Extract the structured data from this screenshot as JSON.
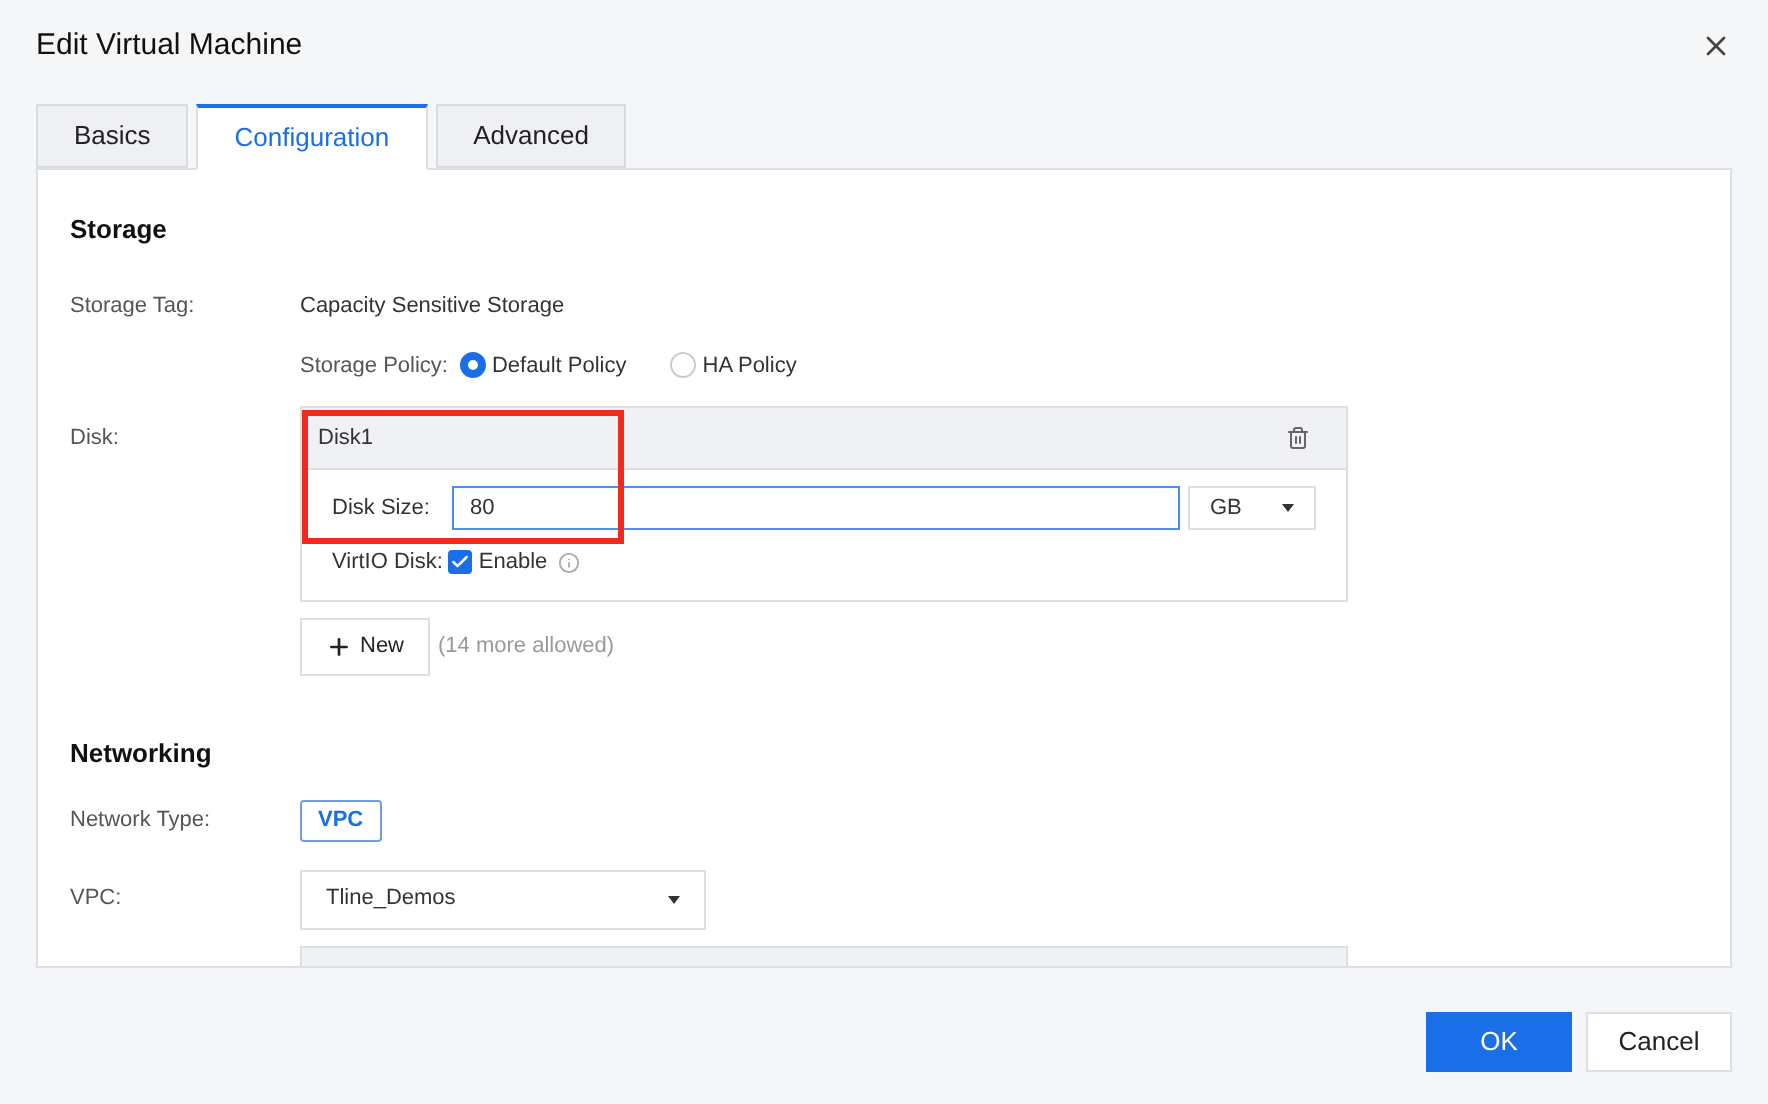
{
  "window": {
    "title": "Edit Virtual Machine"
  },
  "tabs": [
    {
      "label": "Basics",
      "selected": false
    },
    {
      "label": "Configuration",
      "selected": true
    },
    {
      "label": "Advanced",
      "selected": false
    }
  ],
  "storage": {
    "heading": "Storage",
    "tag_label": "Storage Tag:",
    "tag_value": "Capacity Sensitive Storage",
    "policy_label": "Storage Policy:",
    "policies": [
      {
        "label": "Default Policy",
        "selected": true
      },
      {
        "label": "HA Policy",
        "selected": false
      }
    ],
    "disk_label": "Disk:",
    "disks": [
      {
        "title": "Disk1",
        "size_label": "Disk Size:",
        "size_value": "80",
        "unit": "GB",
        "virtio_label": "VirtIO Disk:",
        "virtio_option": "Enable",
        "virtio_checked": true
      }
    ],
    "new_button": "New",
    "allowance": "(14 more allowed)"
  },
  "networking": {
    "heading": "Networking",
    "type_label": "Network Type:",
    "type_value": "VPC",
    "vpc_label": "VPC:",
    "vpc_value": "Tline_Demos"
  },
  "buttons": [
    {
      "label": "OK",
      "kind": "primary"
    },
    {
      "label": "Cancel",
      "kind": "secondary"
    }
  ]
}
